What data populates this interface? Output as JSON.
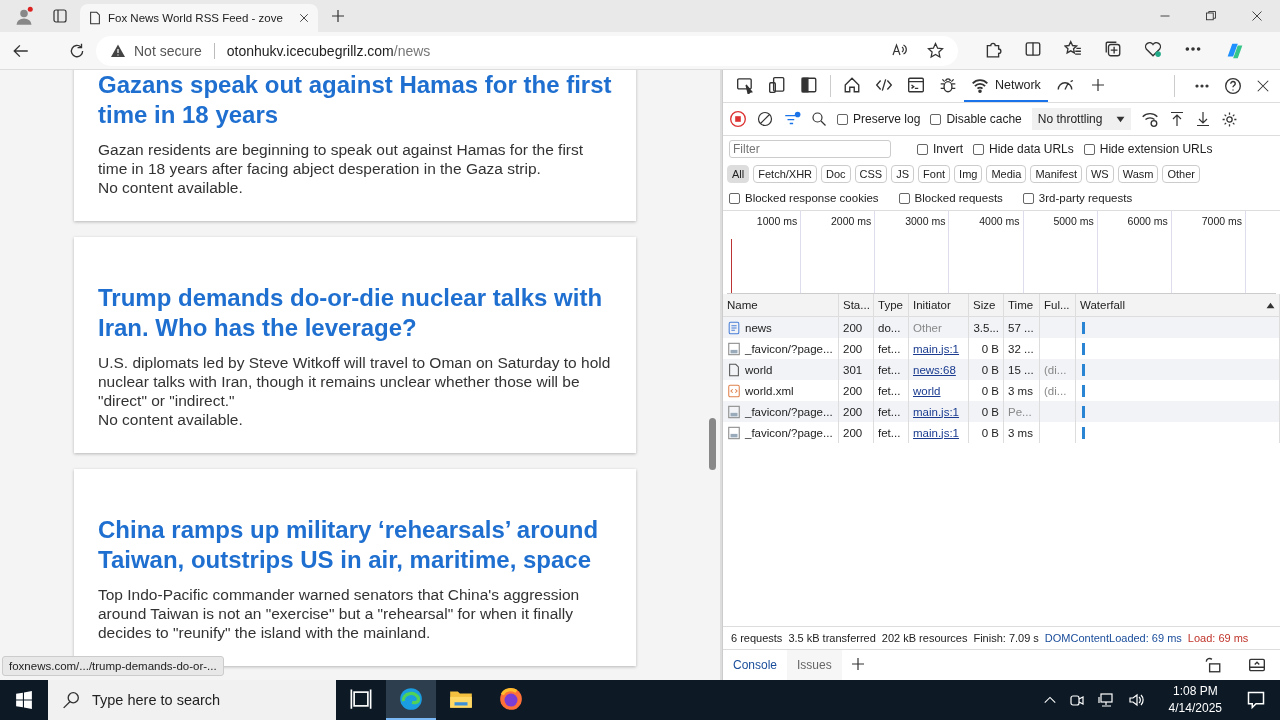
{
  "browser": {
    "tab_title": "Fox News World RSS Feed - zove",
    "address": {
      "security": "Not secure",
      "host": "otonhukv.icecubegrillz.com",
      "path": "/news"
    }
  },
  "articles": [
    {
      "title": "Gazans speak out against Hamas for the first time in 18 years",
      "lines": [
        "Gazan residents are beginning to speak out against Hamas for the first time in 18 years after facing abject desperation in the Gaza strip.",
        "No content available."
      ]
    },
    {
      "title": "Trump demands do-or-die nuclear talks with Iran. Who has the leverage?",
      "lines": [
        "U.S. diplomats led by Steve Witkoff will travel to Oman on Saturday to hold nuclear talks with Iran, though it remains unclear whether those will be \"direct\" or \"indirect.\"",
        "No content available."
      ]
    },
    {
      "title": "China ramps up military ‘rehearsals’ around Taiwan, outstrips US in air, maritime, space",
      "lines": [
        "Top Indo-Pacific commander warned senators that China's aggression around Taiwan is not an \"exercise\" but a \"rehearsal\" for when it finally decides to \"reunify\" the island with the mainland."
      ]
    }
  ],
  "link_preview": "foxnews.com/.../trump-demands-do-or-...",
  "devtools": {
    "tabs": [
      {
        "kind": "inspect",
        "selected": false
      },
      {
        "kind": "device",
        "selected": false
      },
      {
        "kind": "dock",
        "selected": false
      },
      {
        "kind": "home",
        "selected": false
      },
      {
        "kind": "elements",
        "selected": false
      },
      {
        "kind": "console",
        "selected": false
      },
      {
        "kind": "sources",
        "selected": false
      },
      {
        "kind": "network",
        "label": "Network",
        "selected": true
      },
      {
        "kind": "performance",
        "selected": false
      }
    ],
    "options": [
      {
        "label": "Preserve log",
        "checked": false
      },
      {
        "label": "Disable cache",
        "checked": false
      }
    ],
    "throttling": "No throttling",
    "filter": {
      "placeholder": "Filter"
    },
    "filter_options": [
      {
        "label": "Invert",
        "checked": false
      },
      {
        "label": "Hide data URLs",
        "checked": false
      },
      {
        "label": "Hide extension URLs",
        "checked": false
      }
    ],
    "types": [
      {
        "label": "All",
        "selected": true
      },
      {
        "label": "Fetch/XHR",
        "selected": false
      },
      {
        "label": "Doc",
        "selected": false
      },
      {
        "label": "CSS",
        "selected": false
      },
      {
        "label": "JS",
        "selected": false
      },
      {
        "label": "Font",
        "selected": false
      },
      {
        "label": "Img",
        "selected": false
      },
      {
        "label": "Media",
        "selected": false
      },
      {
        "label": "Manifest",
        "selected": false
      },
      {
        "label": "WS",
        "selected": false
      },
      {
        "label": "Wasm",
        "selected": false
      },
      {
        "label": "Other",
        "selected": false
      }
    ],
    "blocked_options": [
      {
        "label": "Blocked response cookies",
        "checked": false
      },
      {
        "label": "Blocked requests",
        "checked": false
      },
      {
        "label": "3rd-party requests",
        "checked": false
      }
    ],
    "overview_ticks": [
      "1000 ms",
      "2000 ms",
      "3000 ms",
      "4000 ms",
      "5000 ms",
      "6000 ms",
      "7000 ms"
    ],
    "columns": [
      "Name",
      "Sta...",
      "Type",
      "Initiator",
      "Size",
      "Time",
      "Ful...",
      "Waterfall"
    ],
    "rows": [
      {
        "kind": "document",
        "name": "news",
        "status": "200",
        "type": "do...",
        "initiator": "Other",
        "initiator_link": false,
        "size": "3.5...",
        "time": "57 ...",
        "time_muted": false,
        "full": ""
      },
      {
        "kind": "image",
        "name": "_favicon/?page...",
        "status": "200",
        "type": "fet...",
        "initiator": "main.js:1",
        "initiator_link": true,
        "size": "0 B",
        "time": "32 ...",
        "time_muted": false,
        "full": ""
      },
      {
        "kind": "file",
        "name": "world",
        "status": "301",
        "type": "fet...",
        "initiator": "news:68",
        "initiator_link": true,
        "size": "0 B",
        "time": "15 ...",
        "time_muted": false,
        "full": "(di..."
      },
      {
        "kind": "xml",
        "name": "world.xml",
        "status": "200",
        "type": "fet...",
        "initiator": "world",
        "initiator_link": true,
        "size": "0 B",
        "time": "3 ms",
        "time_muted": false,
        "full": "(di..."
      },
      {
        "kind": "image",
        "name": "_favicon/?page...",
        "status": "200",
        "type": "fet...",
        "initiator": "main.js:1",
        "initiator_link": true,
        "size": "0 B",
        "time": "Pe...",
        "time_muted": true,
        "full": ""
      },
      {
        "kind": "image",
        "name": "_favicon/?page...",
        "status": "200",
        "type": "fet...",
        "initiator": "main.js:1",
        "initiator_link": true,
        "size": "0 B",
        "time": "3 ms",
        "time_muted": false,
        "full": ""
      }
    ],
    "summary": [
      {
        "kind": "plain",
        "text": "6 requests"
      },
      {
        "kind": "plain",
        "text": "3.5 kB transferred"
      },
      {
        "kind": "plain",
        "text": "202 kB resources"
      },
      {
        "kind": "plain",
        "text": "Finish: 7.09 s"
      },
      {
        "kind": "dcl",
        "text": "DOMContentLoaded: 69 ms"
      },
      {
        "kind": "load",
        "text": "Load: 69 ms"
      }
    ],
    "drawer_tabs": [
      {
        "label": "Console",
        "selected": true
      },
      {
        "label": "Issues",
        "selected": false
      }
    ]
  },
  "taskbar": {
    "search_placeholder": "Type here to search",
    "apps": [
      {
        "kind": "taskview",
        "active": false
      },
      {
        "kind": "edge",
        "active": true
      },
      {
        "kind": "explorer",
        "active": false
      },
      {
        "kind": "firefox",
        "active": false
      }
    ],
    "time": "1:08 PM",
    "date": "4/14/2025"
  }
}
